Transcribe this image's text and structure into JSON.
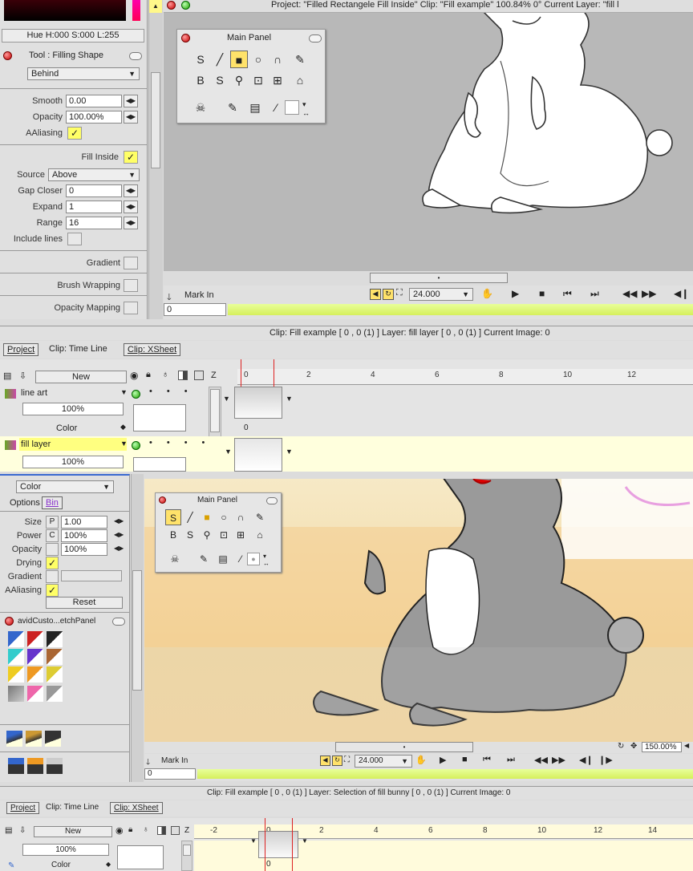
{
  "top_panel": {
    "hsl_readout": "Hue H:000 S:000 L:255",
    "tool_title": "Tool : Filling Shape",
    "mode": "Behind",
    "smooth_label": "Smooth",
    "smooth_value": "0.00",
    "opacity_label": "Opacity",
    "opacity_value": "100.00%",
    "aaliasing_label": "AAliasing",
    "fill_inside_label": "Fill Inside",
    "source_label": "Source",
    "source_value": "Above",
    "gap_closer_label": "Gap Closer",
    "gap_closer_value": "0",
    "expand_label": "Expand",
    "expand_value": "1",
    "range_label": "Range",
    "range_value": "16",
    "include_lines_label": "Include lines",
    "gradient_label": "Gradient",
    "brush_wrapping_label": "Brush Wrapping",
    "opacity_mapping_label": "Opacity Mapping"
  },
  "top_title": "Project:  \"Filled Rectangele Fill Inside\"  Clip: \"Fill example\"   100.84%   0°   Current Layer: \"fill l",
  "main_panel_title": "Main Panel",
  "main_panel2_title": "Main Panel",
  "top_transport": {
    "mark_in": "Mark In",
    "frame_value": "24.000",
    "frame_field": "0"
  },
  "top_status": "Clip: Fill example [ 0 , 0  (1) ]          Layer: fill layer [ 0 , 0  (1) ]    Current Image: 0",
  "top_tabs": {
    "project": "Project",
    "timeline": "Clip: Time Line",
    "xsheet": "Clip: XSheet"
  },
  "timeline1": {
    "new_label": "New",
    "z_label": "Z",
    "ticks": [
      "0",
      "2",
      "4",
      "6",
      "8",
      "10",
      "12"
    ],
    "layers": [
      {
        "name": "line art",
        "opacity": "100%",
        "blend": "Color"
      },
      {
        "name": "fill layer",
        "opacity": "100%"
      }
    ],
    "frame_num": "0"
  },
  "bottom_panel": {
    "color_select": "Color",
    "options_tab": "Options",
    "bin_tab": "Bin",
    "size_label": "Size",
    "size_flag": "P",
    "size_value": "1.00",
    "power_label": "Power",
    "power_flag": "C",
    "power_value": "100%",
    "opacity_label": "Opacity",
    "opacity_value": "100%",
    "drying_label": "Drying",
    "gradient_label": "Gradient",
    "aaliasing_label": "AAliasing",
    "reset_label": "Reset",
    "sketch_panel_title": "avidCusto...etchPanel"
  },
  "bottom_transport": {
    "mark_in": "Mark In",
    "frame_value": "24.000",
    "frame_field": "0",
    "zoom": "150.00%"
  },
  "bottom_status": "Clip: Fill example [ 0 , 0  (1) ]          Layer: Selection of fill bunny [ 0 , 0  (1) ]    Current Image: 0",
  "bottom_tabs": {
    "project": "Project",
    "timeline": "Clip: Time Line",
    "xsheet": "Clip: XSheet"
  },
  "timeline2": {
    "new_label": "New",
    "z_label": "Z",
    "ticks": [
      "-2",
      "0",
      "2",
      "4",
      "6",
      "8",
      "10",
      "12",
      "14"
    ],
    "opacity": "100%",
    "blend": "Color",
    "frame_num": "0"
  },
  "colors": {
    "accent": "#ffff66",
    "panel": "#e0e0e0",
    "canvas_top": "#b8b8b8",
    "canvas_bottom": "#f4dfb0"
  }
}
